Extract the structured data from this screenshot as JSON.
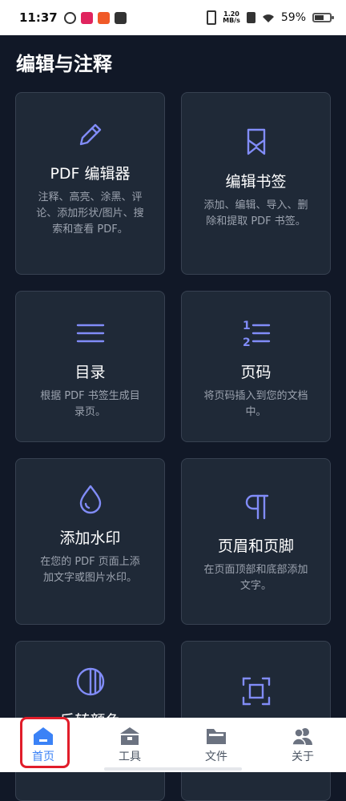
{
  "status_bar": {
    "time": "11:37",
    "net_speed": "1.20",
    "net_unit": "MB/s",
    "battery": "59%",
    "battery_level": 0.59
  },
  "page": {
    "title": "编辑与注释"
  },
  "cards": [
    {
      "icon": "pencil-icon",
      "title": "PDF 编辑器",
      "desc": "注释、高亮、涂黑、评论、添加形状/图片、搜索和查看 PDF。"
    },
    {
      "icon": "bookmark-icon",
      "title": "编辑书签",
      "desc": "添加、编辑、导入、删除和提取 PDF 书签。"
    },
    {
      "icon": "list-icon",
      "title": "目录",
      "desc": "根据 PDF 书签生成目录页。"
    },
    {
      "icon": "numbered-list-icon",
      "title": "页码",
      "desc": "将页码插入到您的文档中。"
    },
    {
      "icon": "droplet-icon",
      "title": "添加水印",
      "desc": "在您的 PDF 页面上添加文字或图片水印。"
    },
    {
      "icon": "pilcrow-icon",
      "title": "页眉和页脚",
      "desc": "在页面顶部和底部添加文字。"
    },
    {
      "icon": "contrast-icon",
      "title": "反转颜色",
      "desc": ""
    },
    {
      "icon": "crop-frame-icon",
      "title": "",
      "desc": ""
    }
  ],
  "nav": {
    "items": [
      {
        "label": "首页",
        "icon": "home-icon",
        "active": true
      },
      {
        "label": "工具",
        "icon": "toolbox-icon",
        "active": false
      },
      {
        "label": "文件",
        "icon": "folder-icon",
        "active": false
      },
      {
        "label": "关于",
        "icon": "users-icon",
        "active": false
      }
    ]
  },
  "colors": {
    "background": "#111827",
    "card": "#1f2937",
    "accent": "#818cf8",
    "nav_active": "#3b82f6",
    "highlight": "#e11d2a"
  }
}
